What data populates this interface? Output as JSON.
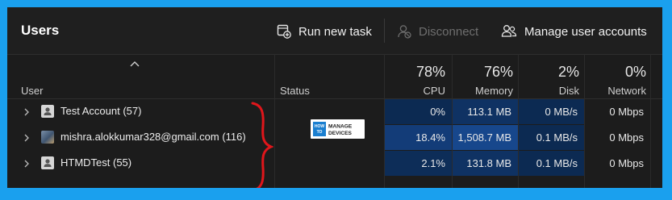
{
  "toolbar": {
    "title": "Users",
    "run_new_task": "Run new task",
    "disconnect": "Disconnect",
    "manage_accounts": "Manage user accounts"
  },
  "columns": {
    "user": "User",
    "status": "Status",
    "cpu": {
      "pct": "78%",
      "label": "CPU"
    },
    "memory": {
      "pct": "76%",
      "label": "Memory"
    },
    "disk": {
      "pct": "2%",
      "label": "Disk"
    },
    "network": {
      "pct": "0%",
      "label": "Network"
    }
  },
  "rows": [
    {
      "name": "Test Account (57)",
      "cpu": "0%",
      "memory": "113.1 MB",
      "disk": "0 MB/s",
      "network": "0 Mbps"
    },
    {
      "name": "mishra.alokkumar328@gmail.com (116)",
      "cpu": "18.4%",
      "memory": "1,508.7 MB",
      "disk": "0.1 MB/s",
      "network": "0 Mbps"
    },
    {
      "name": "HTMDTest (55)",
      "cpu": "2.1%",
      "memory": "131.8 MB",
      "disk": "0.1 MB/s",
      "network": "0 Mbps"
    }
  ],
  "logo": {
    "line1a": "HOW",
    "line1b": "TO",
    "line2a": "MANAGE",
    "line2b": "DEVICES"
  },
  "colors": {
    "background_frame": "#1aa0ee",
    "heat_low": "#0c2a52",
    "heat_mid": "#10346a",
    "heat_high": "#17478c",
    "annotation_bracket": "#e0161b"
  }
}
